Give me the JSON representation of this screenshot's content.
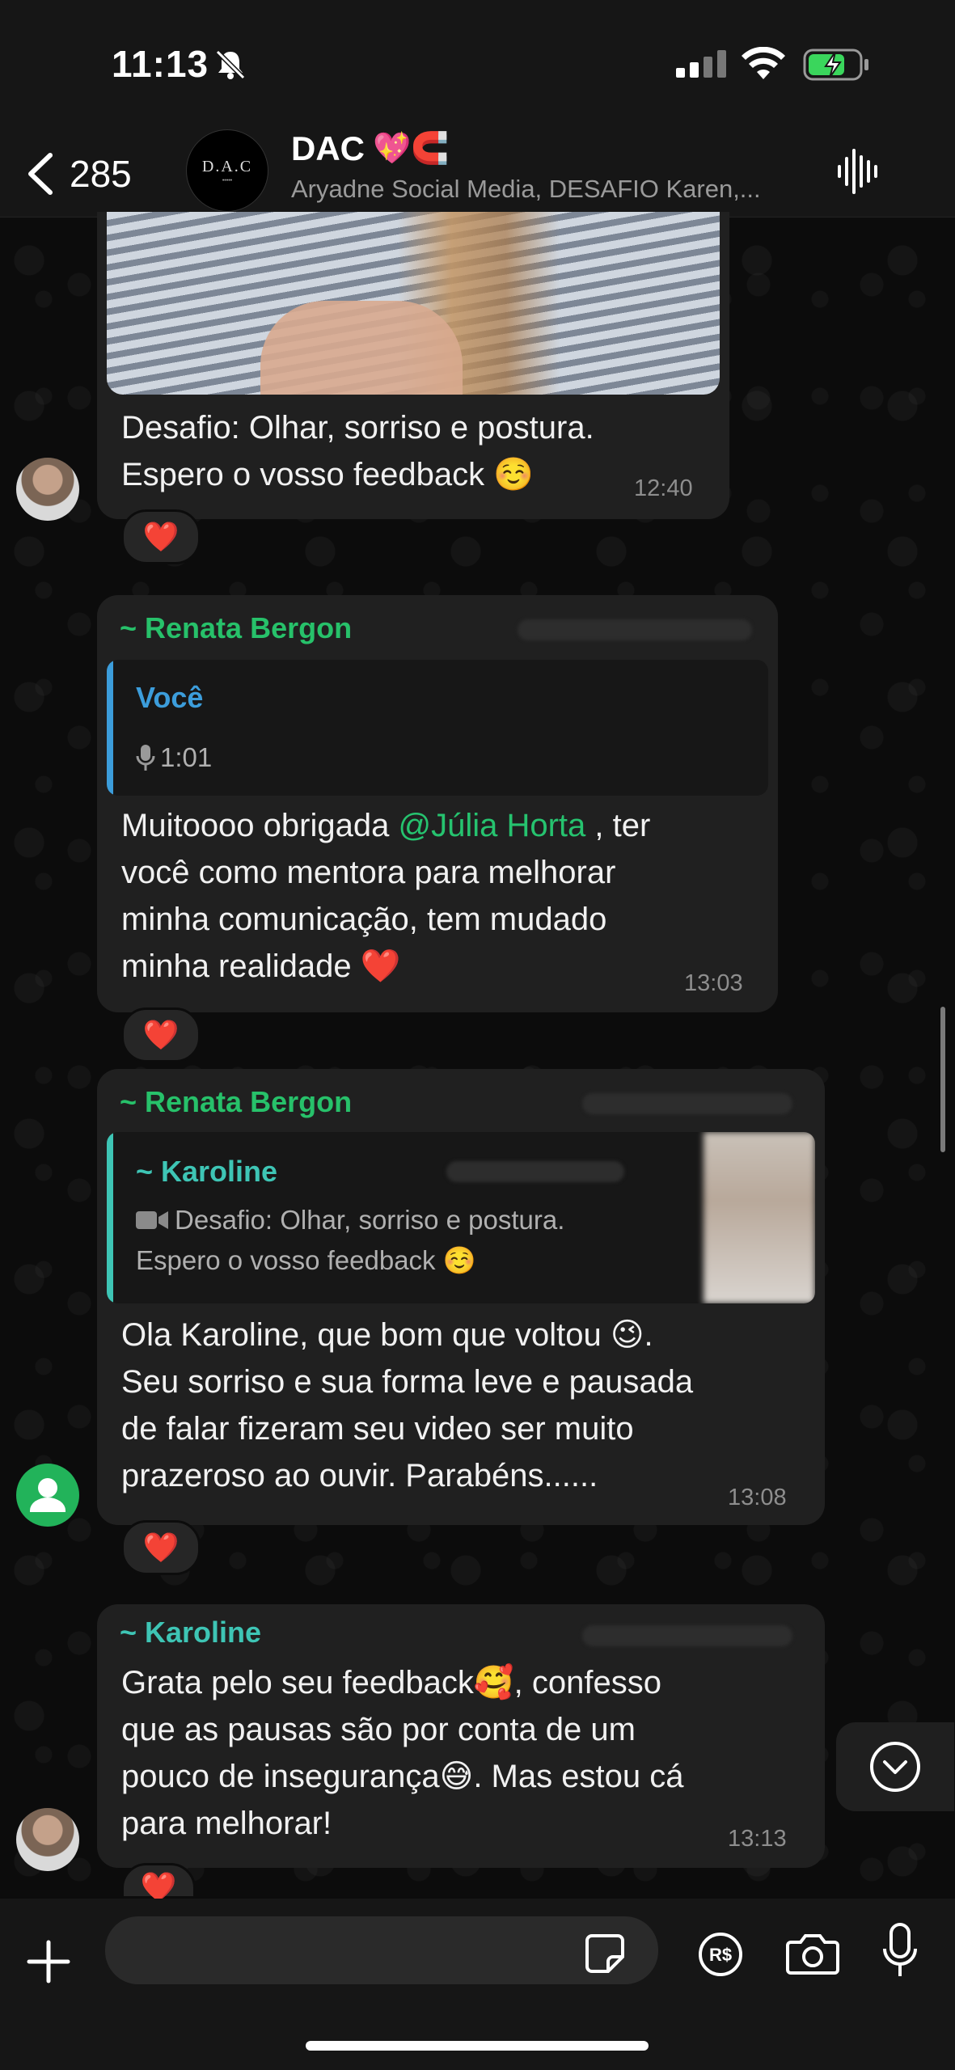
{
  "status_bar": {
    "time": "11:13"
  },
  "header": {
    "back_count": "285",
    "group_name": "DAC",
    "group_name_emoji": "💖🧲",
    "avatar_text": "D.A.C",
    "members": "Aryadne Social Media, DESAFIO Karen,..."
  },
  "messages": [
    {
      "text_line1": "Desafio: Olhar, sorriso e postura.",
      "text_line2": "Espero o vosso feedback ☺️",
      "time": "12:40",
      "reaction": "❤️"
    },
    {
      "sender": "~ Renata Bergon",
      "quote_name": "Você",
      "quote_audio": "1:01",
      "line1_a": "Muitoooo obrigada ",
      "mention": "@Júlia Horta",
      "line1_b": " , ter",
      "line2": "você como mentora para melhorar",
      "line3": "minha comunicação, tem mudado",
      "line4": "minha realidade ❤️",
      "time": "13:03",
      "reaction": "❤️"
    },
    {
      "sender": "~ Renata Bergon",
      "quote_name": "~ Karoline",
      "quote_line1": "Desafio: Olhar, sorriso e postura.",
      "quote_line2": "Espero o vosso feedback ☺️",
      "line1": "Ola Karoline, que bom que voltou 😉.",
      "line2": "Seu sorriso e sua forma leve e pausada",
      "line3": "de falar fizeram seu video ser muito",
      "line4": "prazeroso ao ouvir. Parabéns......",
      "time": "13:08",
      "reaction": "❤️"
    },
    {
      "sender": "~ Karoline",
      "line1": "Grata pelo seu feedback🥰, confesso",
      "line2": "que as pausas são por conta de um",
      "line3": "pouco de insegurança😅. Mas estou cá",
      "line4": "para melhorar!",
      "time": "13:13",
      "reaction": "❤️"
    }
  ],
  "colors": {
    "sender_green": "#27c16a",
    "sender_teal": "#3ec5b5",
    "quote_blue": "#3c9ddb",
    "bubble": "#202020"
  },
  "icons": [
    "bell-slash-icon",
    "signal-icon",
    "wifi-icon",
    "battery-charging-icon",
    "chevron-left-icon",
    "audio-wave-icon",
    "mic-icon",
    "video-icon",
    "chevron-down-icon",
    "plus-icon",
    "sticker-icon",
    "pix-icon",
    "camera-icon",
    "microphone-icon"
  ]
}
